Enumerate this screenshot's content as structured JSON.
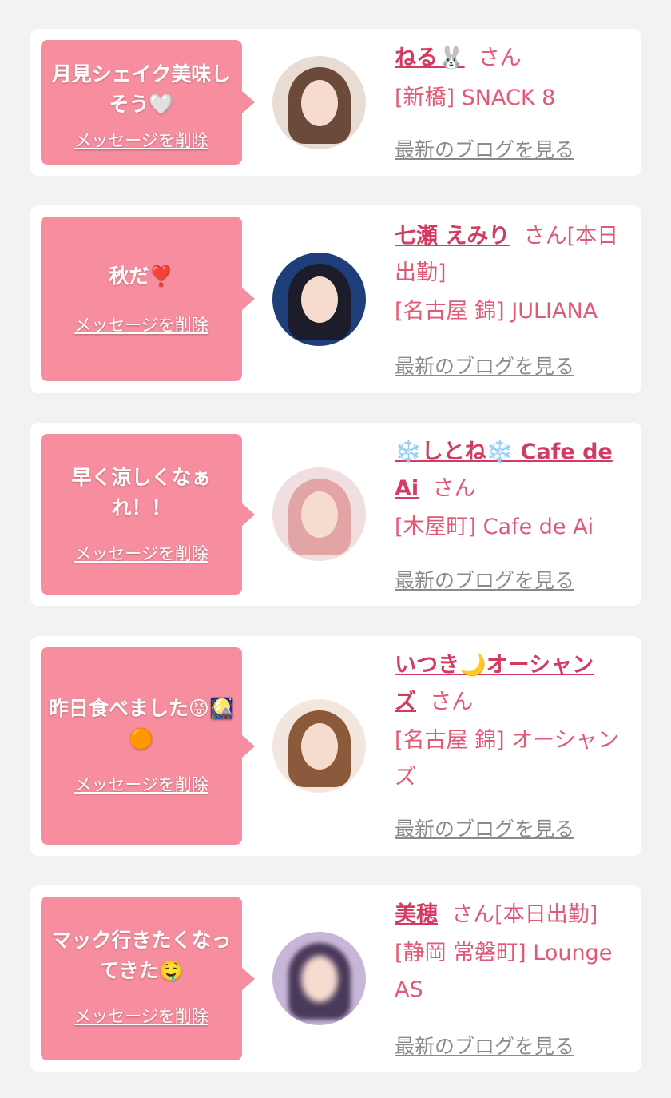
{
  "colors": {
    "page_bg": "#f2f2f2",
    "card_bg": "#ffffff",
    "bubble_bg": "#f68e9f",
    "name_color": "#d23c62",
    "text_pink": "#e05a78",
    "blog_gray": "#8a8a8a"
  },
  "delete_label": "メッセージを削除",
  "blog_label": "最新のブログを見る",
  "cards": [
    {
      "message": "月見シェイク美味しそう🤍",
      "name": "ねる🐰",
      "suffix": "さん",
      "area": "[新橋]",
      "store": "SNACK 8"
    },
    {
      "message": "秋だ❣️",
      "name": "七瀬 えみり",
      "suffix": "さん[本日出勤]",
      "area": "[名古屋 錦]",
      "store": "JULIANA"
    },
    {
      "message": "早く涼しくなぁれ！！",
      "name": "❄️しとね❄️ Cafe de Ai",
      "suffix": "さん",
      "area": "[木屋町]",
      "store": "Cafe de Ai"
    },
    {
      "message": "昨日食べました😝🎑🟠",
      "name": "いつき🌙オーシャンズ",
      "suffix": "さん",
      "area": "[名古屋 錦]",
      "store": "オーシャンズ"
    },
    {
      "message": "マック行きたくなってきた🤤",
      "name": "美穂",
      "suffix": "さん[本日出勤]",
      "area": "[静岡 常磐町]",
      "store": "Lounge AS"
    }
  ]
}
